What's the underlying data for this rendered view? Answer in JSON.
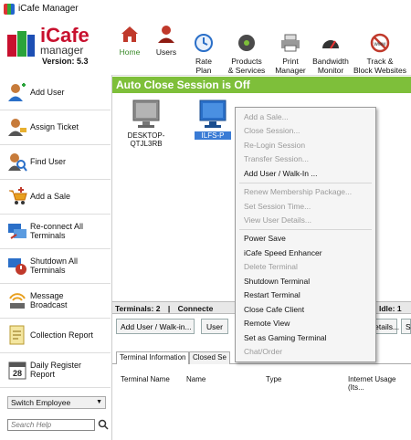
{
  "window": {
    "title": "iCafe Manager"
  },
  "logo": {
    "brand": "iCafe",
    "brand2": "manager",
    "version": "Version: 5.3"
  },
  "toolbar": {
    "home": "Home",
    "users": "Users",
    "rate_plan": "Rate\nPlan",
    "products": "Products\n& Services",
    "print": "Print\nManager",
    "bandwidth": "Bandwidth\nMonitor",
    "track": "Track &\nBlock Websites"
  },
  "sidebar": {
    "items": [
      {
        "label": "Add User",
        "icon": "add-user-icon"
      },
      {
        "label": "Assign Ticket",
        "icon": "assign-ticket-icon"
      },
      {
        "label": "Find User",
        "icon": "find-user-icon"
      },
      {
        "label": "Add a Sale",
        "icon": "cart-icon"
      },
      {
        "label": "Re-connect All\nTerminals",
        "icon": "reconnect-icon"
      },
      {
        "label": "Shutdown All\nTerminals",
        "icon": "shutdown-icon"
      },
      {
        "label": "Message\nBroadcast",
        "icon": "broadcast-icon"
      },
      {
        "label": "Collection Report",
        "icon": "report-icon"
      },
      {
        "label": "Daily Register\nReport",
        "icon": "calendar-icon"
      }
    ],
    "switch_employee": "Switch Employee",
    "search_placeholder": "Search Help"
  },
  "main": {
    "banner": "Auto Close Session is Off",
    "terminals": [
      {
        "name": "DESKTOP-QTJL3RB",
        "status": "offline"
      },
      {
        "name": "ILFS-P",
        "status": "selected"
      }
    ],
    "status_left": "Terminals: 2",
    "status_mid": "Connecte",
    "status_right": "Idle: 1",
    "btn_add_user": "Add User / Walk-in...",
    "btn_user": "User",
    "btn_details": "Details...",
    "btn_s": "S",
    "tab_info": "Terminal Information",
    "tab_closed": "Closed Se",
    "col_terminal": "Terminal Name",
    "col_name": "Name",
    "col_type": "Type",
    "col_usage": "Internet Usage (Its..."
  },
  "context_menu": {
    "items": [
      {
        "label": "Add a Sale...",
        "enabled": false
      },
      {
        "label": "Close Session...",
        "enabled": false
      },
      {
        "label": "Re-Login Session",
        "enabled": false
      },
      {
        "label": "Transfer Session...",
        "enabled": false
      },
      {
        "label": "Add User / Walk-In ...",
        "enabled": true
      },
      {
        "label": "Renew Membership Package...",
        "enabled": false
      },
      {
        "label": "Set Session Time...",
        "enabled": false
      },
      {
        "label": "View User Details...",
        "enabled": false
      },
      {
        "label": "Power Save",
        "enabled": true
      },
      {
        "label": "iCafe Speed Enhancer",
        "enabled": true
      },
      {
        "label": "Delete Terminal",
        "enabled": false
      },
      {
        "label": "Shutdown Terminal",
        "enabled": true
      },
      {
        "label": "Restart Terminal",
        "enabled": true
      },
      {
        "label": "Close Cafe Client",
        "enabled": true
      },
      {
        "label": "Remote View",
        "enabled": true
      },
      {
        "label": "Set as Gaming Terminal",
        "enabled": true
      },
      {
        "label": "Chat/Order",
        "enabled": false
      }
    ]
  },
  "colors": {
    "banner": "#7ebf3a",
    "selected": "#3a7bd5",
    "brand": "#c8102e"
  }
}
